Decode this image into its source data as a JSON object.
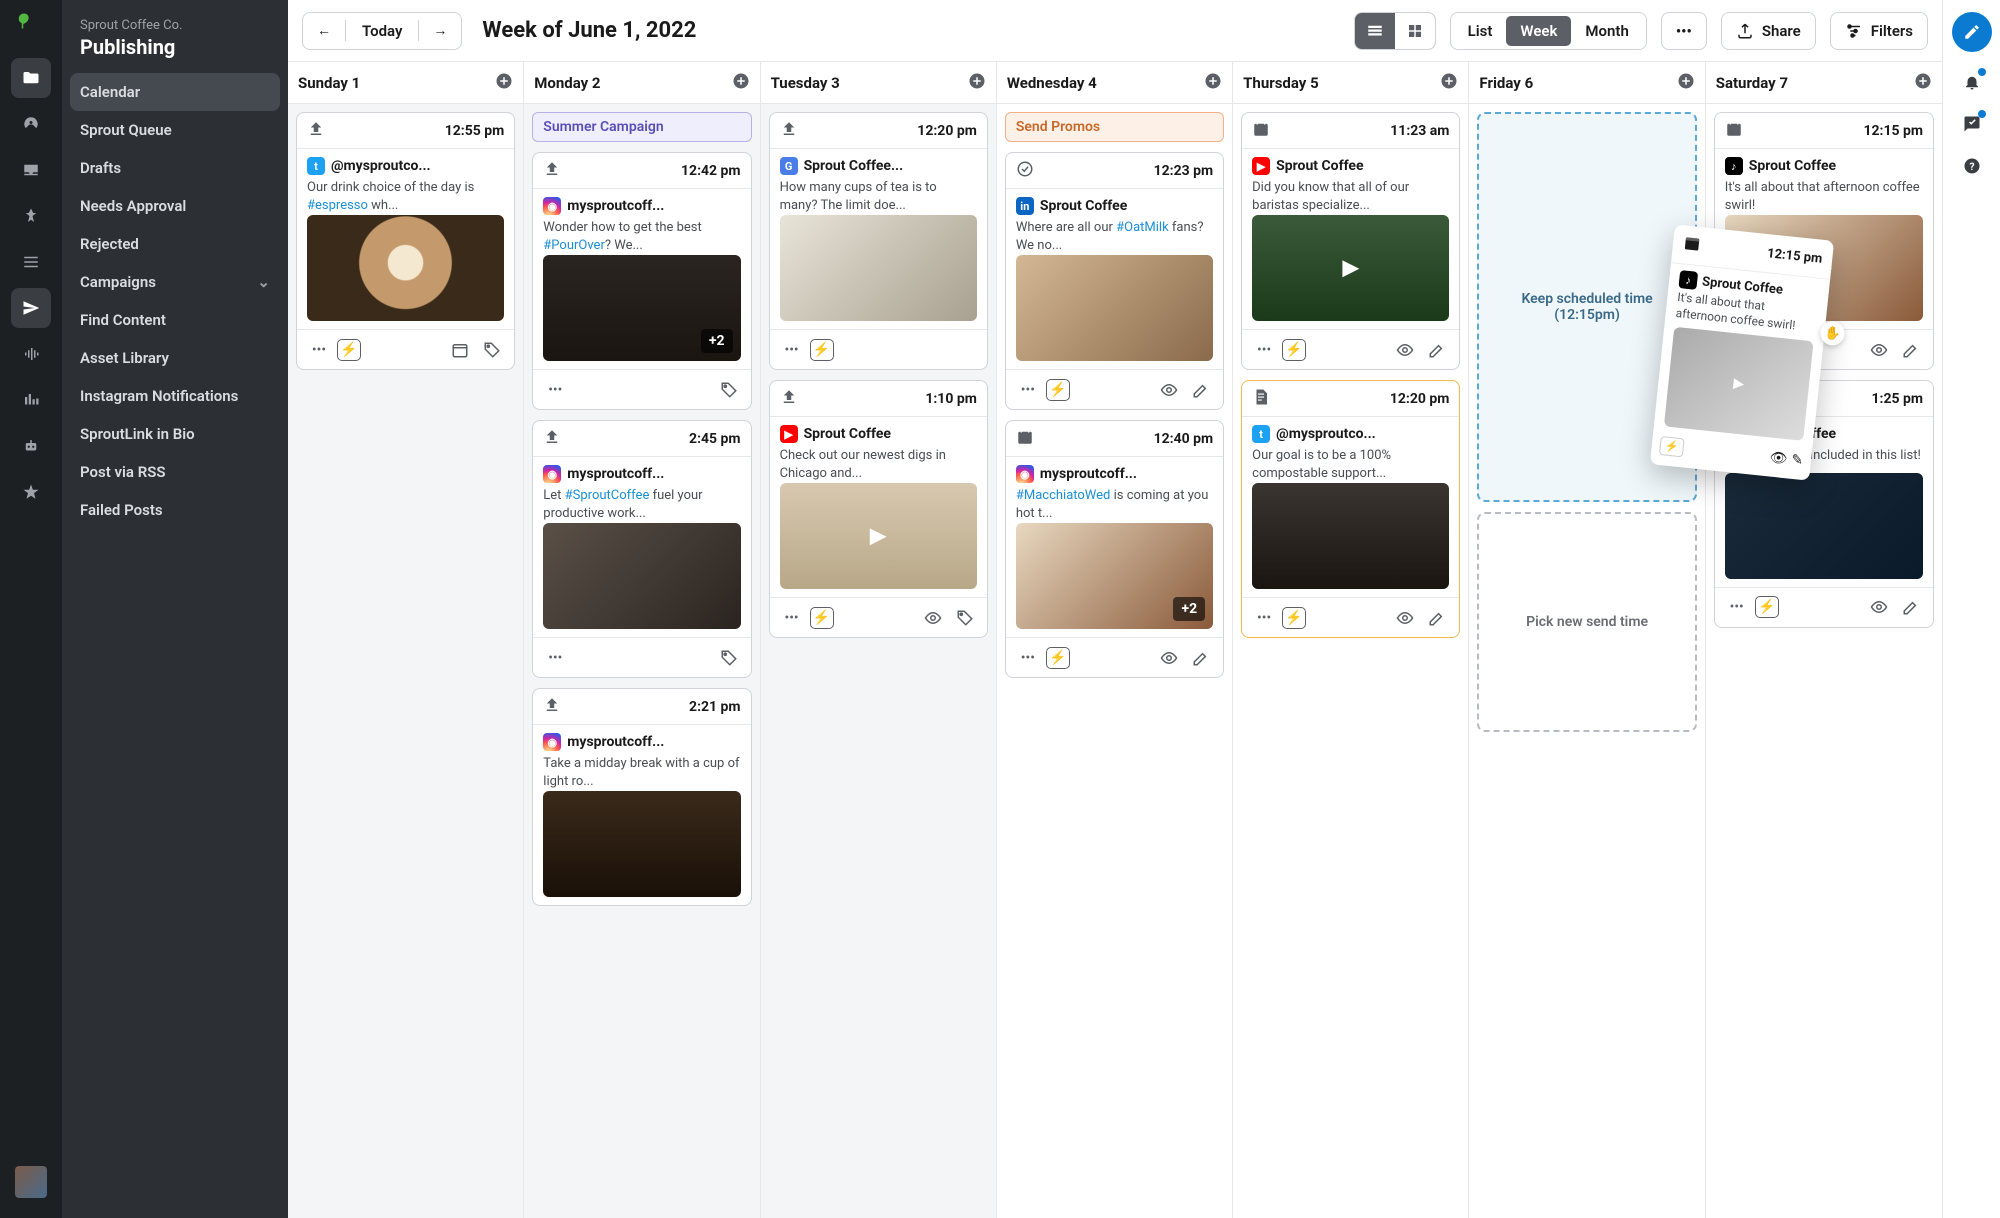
{
  "company": "Sprout Coffee Co.",
  "section": "Publishing",
  "topbar": {
    "today": "Today",
    "title": "Week of June 1, 2022",
    "views": {
      "list": "List",
      "week": "Week",
      "month": "Month"
    },
    "share": "Share",
    "filters": "Filters"
  },
  "sidebar": [
    {
      "label": "Calendar",
      "active": true
    },
    {
      "label": "Sprout Queue"
    },
    {
      "label": "Drafts"
    },
    {
      "label": "Needs Approval"
    },
    {
      "label": "Rejected"
    },
    {
      "label": "Campaigns",
      "expandable": true
    },
    {
      "label": "Find Content"
    },
    {
      "label": "Asset Library"
    },
    {
      "label": "Instagram Notifications"
    },
    {
      "label": "SproutLink in Bio"
    },
    {
      "label": "Post via RSS"
    },
    {
      "label": "Failed Posts"
    }
  ],
  "days": [
    "Sunday 1",
    "Monday 2",
    "Tuesday 3",
    "Wednesday 4",
    "Thursday 5",
    "Friday 6",
    "Saturday 7"
  ],
  "campaigns": {
    "mon": "Summer Campaign",
    "wed": "Send Promos"
  },
  "dropzones": {
    "keep": "Keep scheduled time (12:15pm)",
    "pick": "Pick new send time"
  },
  "floating": {
    "time": "12:15 pm",
    "account": "Sprout Coffee",
    "text": "It's all about that afternoon coffee swirl!"
  },
  "cards": {
    "sun1": {
      "time": "12:55 pm",
      "acc": "@mysproutco...",
      "pre": "Our drink choice of the day is ",
      "tag": "#espresso",
      "post": " wh..."
    },
    "mon1": {
      "time": "12:42 pm",
      "acc": "mysproutcoff...",
      "pre": "Wonder how to get the best ",
      "tag": "#PourOver",
      "post": "? We...",
      "badge": "+2"
    },
    "mon2": {
      "time": "2:45 pm",
      "acc": "mysproutcoff...",
      "pre": "Let ",
      "tag": "#SproutCoffee",
      "post": " fuel your productive work..."
    },
    "mon3": {
      "time": "2:21 pm",
      "acc": "mysproutcoff...",
      "txt": "Take a midday break with a cup of light ro..."
    },
    "tue1": {
      "time": "12:20 pm",
      "acc": "Sprout Coffee...",
      "txt": "How many cups of tea is to many? The limit doe..."
    },
    "tue2": {
      "time": "1:10 pm",
      "acc": "Sprout Coffee",
      "txt": "Check out our newest digs in Chicago and..."
    },
    "wed1": {
      "time": "12:23 pm",
      "acc": "Sprout Coffee",
      "pre": "Where are all our ",
      "tag": "#OatMilk",
      "post": " fans? We no..."
    },
    "wed2": {
      "time": "12:40 pm",
      "acc": "mysproutcoff...",
      "tag": "#MacchiatoWed",
      "post": " is coming at you hot t...",
      "badge": "+2"
    },
    "thu1": {
      "time": "11:23 am",
      "acc": "Sprout Coffee",
      "txt": "Did you know that all of our baristas specialize..."
    },
    "thu2": {
      "time": "12:20 pm",
      "acc": "@mysproutco...",
      "txt": "Our goal is to be a 100% compostable support..."
    },
    "sat1": {
      "time": "12:15 pm",
      "acc": "Sprout Coffee",
      "txt": "It's all about that afternoon coffee swirl!"
    },
    "sat2": {
      "time": "1:25 pm",
      "acc": "Sprout Coffee",
      "txt": "Honored to be included in this list!"
    }
  }
}
